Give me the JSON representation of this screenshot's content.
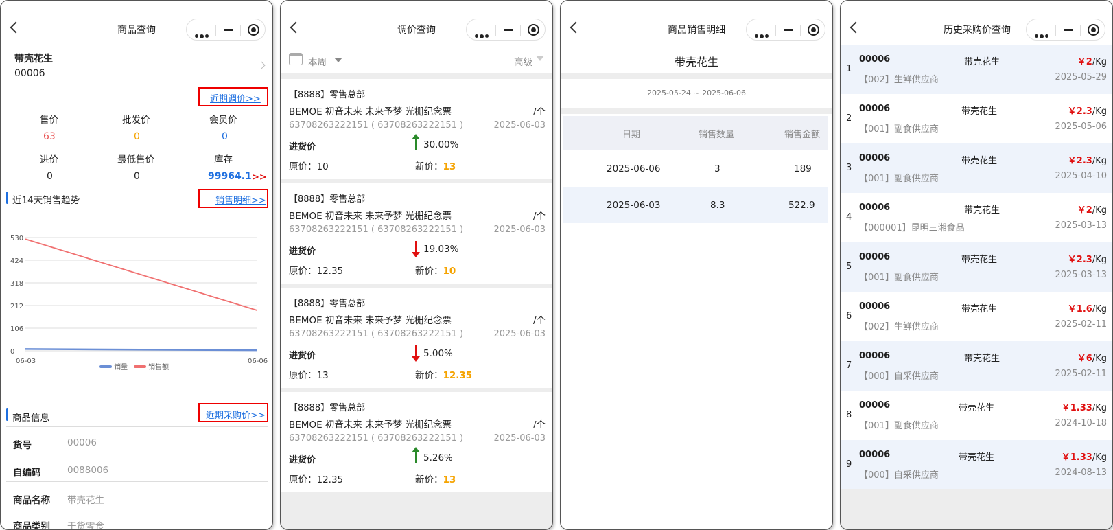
{
  "panel1": {
    "title": "商品查询",
    "product_name": "带壳花生",
    "product_code": "00006",
    "recent_adjust_link": "近期调价>>",
    "metrics": [
      {
        "label": "售价",
        "value": "63",
        "color": "#e85050"
      },
      {
        "label": "批发价",
        "value": "0",
        "color": "#f5a300"
      },
      {
        "label": "会员价",
        "value": "0",
        "color": "#1e6fe0"
      },
      {
        "label": "进价",
        "value": "0",
        "color": "#222222"
      },
      {
        "label": "最低售价",
        "value": "0",
        "color": "#222222"
      },
      {
        "label": "库存",
        "value": "99964.1",
        "color": "#1e6fe0"
      }
    ],
    "stock_suffix": ">>",
    "trend_title": "近14天销售趋势",
    "sales_detail_link": "销售明细>>",
    "info_title": "商品信息",
    "recent_purchase_link": "近期采购价>>",
    "info_rows": [
      {
        "label": "货号",
        "value": "00006"
      },
      {
        "label": "自编码",
        "value": "0088006"
      },
      {
        "label": "商品名称",
        "value": "带壳花生"
      },
      {
        "label": "商品类别",
        "value": "干货零食"
      }
    ]
  },
  "chart_data": {
    "type": "line",
    "title": "",
    "xlabel": "",
    "ylabel": "",
    "x": [
      "06-03",
      "06-06"
    ],
    "y_ticks": [
      "530",
      "424",
      "318",
      "212",
      "106",
      "0"
    ],
    "ylim": [
      0,
      530
    ],
    "grid": true,
    "legend_placement": "bottom",
    "series": [
      {
        "name": "销量",
        "color": "#6b8fd6",
        "values": [
          8.3,
          3
        ]
      },
      {
        "name": "销售额",
        "color": "#f07070",
        "values": [
          522.9,
          189
        ]
      }
    ]
  },
  "panel2": {
    "title": "调价查询",
    "period": "本周",
    "advanced": "高级",
    "cards": [
      {
        "store": "【8888】零售总部",
        "product": "BEMOE 初音未来 未来予梦 光栅纪念票",
        "unit": "/个",
        "code": "63708263222151 ( 63708263222151 )",
        "date": "2025-06-03",
        "kind": "进货价",
        "direction": "up",
        "pct": "30.00%",
        "old_label": "原价：",
        "old": "10",
        "new_label": "新价：",
        "new": "13"
      },
      {
        "store": "【8888】零售总部",
        "product": "BEMOE 初音未来 未来予梦 光栅纪念票",
        "unit": "/个",
        "code": "63708263222151 ( 63708263222151 )",
        "date": "2025-06-03",
        "kind": "进货价",
        "direction": "down",
        "pct": "19.03%",
        "old_label": "原价：",
        "old": "12.35",
        "new_label": "新价：",
        "new": "10"
      },
      {
        "store": "【8888】零售总部",
        "product": "BEMOE 初音未来 未来予梦 光栅纪念票",
        "unit": "/个",
        "code": "63708263222151 ( 63708263222151 )",
        "date": "2025-06-03",
        "kind": "进货价",
        "direction": "down",
        "pct": "5.00%",
        "old_label": "原价：",
        "old": "13",
        "new_label": "新价：",
        "new": "12.35"
      },
      {
        "store": "【8888】零售总部",
        "product": "BEMOE 初音未来 未来予梦 光栅纪念票",
        "unit": "/个",
        "code": "63708263222151 ( 63708263222151 )",
        "date": "2025-06-03",
        "kind": "进货价",
        "direction": "up",
        "pct": "5.26%",
        "old_label": "原价：",
        "old": "12.35",
        "new_label": "新价：",
        "new": "13"
      }
    ]
  },
  "panel3": {
    "title": "商品销售明细",
    "product_name": "带壳花生",
    "date_range": "2025-05-24 ~ 2025-06-06",
    "headers": [
      "日期",
      "销售数量",
      "销售金额"
    ],
    "rows": [
      [
        "2025-06-06",
        "3",
        "189"
      ],
      [
        "2025-06-03",
        "8.3",
        "522.9"
      ]
    ]
  },
  "panel4": {
    "title": "历史采购价查询",
    "rows": [
      {
        "idx": "1",
        "code": "00006",
        "name": "带壳花生",
        "price": "￥2",
        "unit": "/Kg",
        "supplier": "【002】生鲜供应商",
        "date": "2025-05-29"
      },
      {
        "idx": "2",
        "code": "00006",
        "name": "带壳花生",
        "price": "￥2.3",
        "unit": "/Kg",
        "supplier": "【001】副食供应商",
        "date": "2025-05-06"
      },
      {
        "idx": "3",
        "code": "00006",
        "name": "带壳花生",
        "price": "￥2.3",
        "unit": "/Kg",
        "supplier": "【001】副食供应商",
        "date": "2025-04-10"
      },
      {
        "idx": "4",
        "code": "00006",
        "name": "带壳花生",
        "price": "￥2",
        "unit": "/Kg",
        "supplier": "【000001】昆明三湘食品",
        "date": "2025-03-13"
      },
      {
        "idx": "5",
        "code": "00006",
        "name": "带壳花生",
        "price": "￥2.3",
        "unit": "/Kg",
        "supplier": "【001】副食供应商",
        "date": "2025-03-13"
      },
      {
        "idx": "6",
        "code": "00006",
        "name": "带壳花生",
        "price": "￥1.6",
        "unit": "/Kg",
        "supplier": "【002】生鲜供应商",
        "date": "2025-02-11"
      },
      {
        "idx": "7",
        "code": "00006",
        "name": "带壳花生",
        "price": "￥6",
        "unit": "/Kg",
        "supplier": "【000】自采供应商",
        "date": "2025-02-11"
      },
      {
        "idx": "8",
        "code": "00006",
        "name": "带壳花生",
        "price": "￥1.33",
        "unit": "/Kg",
        "supplier": "【001】副食供应商",
        "date": "2024-10-18"
      },
      {
        "idx": "9",
        "code": "00006",
        "name": "带壳花生",
        "price": "￥1.33",
        "unit": "/Kg",
        "supplier": "【000】自采供应商",
        "date": "2024-08-13"
      }
    ]
  }
}
